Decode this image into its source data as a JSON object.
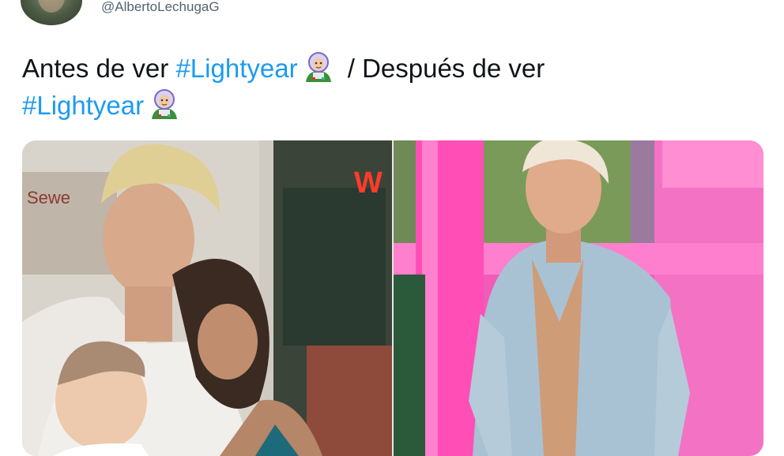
{
  "tweet": {
    "author_handle": "@AlbertoLechugaG",
    "text_before_1": "Antes de ver ",
    "hashtag_1": "#Lightyear",
    "text_middle": " / Después de ver",
    "hashtag_2": "#Lightyear",
    "emoji": "buzz-lightyear-emoji"
  },
  "media": {
    "left_sign_text": "W",
    "store_sign_text": "Sewe"
  },
  "colors": {
    "hashtag": "#1d9bf0",
    "text": "#0f1419",
    "handle": "#536471",
    "pink": "#f04fb0"
  }
}
